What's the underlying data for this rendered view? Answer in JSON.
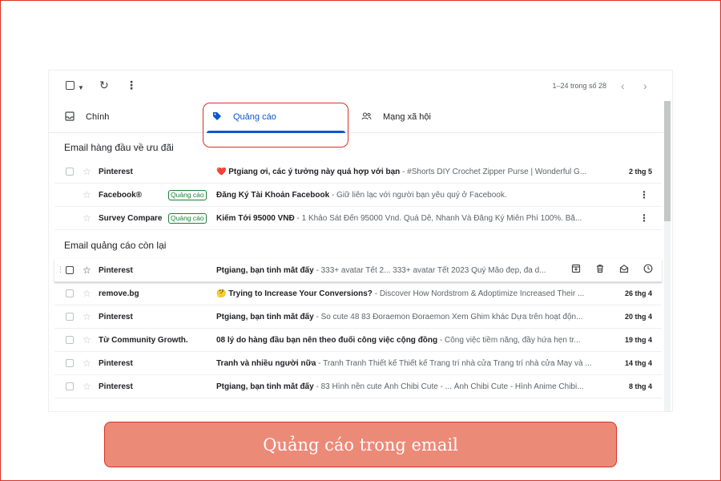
{
  "toolbar": {
    "range_text": "1–24 trong số 28"
  },
  "tabs": [
    {
      "label": "Chính",
      "icon": "inbox-icon"
    },
    {
      "label": "Quảng cáo",
      "icon": "tag-icon",
      "selected": true
    },
    {
      "label": "Mạng xã hội",
      "icon": "people-icon"
    }
  ],
  "sections": {
    "top_title": "Email hàng đầu về ưu đãi",
    "rest_title": "Email quảng cáo còn lại"
  },
  "top_rows": [
    {
      "sender": "Pinterest",
      "badge": "",
      "prefix": "❤️ ",
      "subject": "Ptgiang ơi, các ý tưởng này quá hợp với bạn",
      "preview": "#Shorts DIY Crochet Zipper Purse | Wonderful G...",
      "date": "2 thg 5"
    },
    {
      "sender": "Facebook®",
      "badge": "Quảng cáo",
      "prefix": "",
      "subject": "Đăng Ký Tài Khoản Facebook",
      "preview": "Giữ liên lạc với người bạn yêu quý ở Facebook.",
      "date": ""
    },
    {
      "sender": "Survey Compare",
      "badge": "Quảng cáo",
      "prefix": "",
      "subject": "Kiếm Tới 95000 VNĐ",
      "preview": "1 Khảo Sát Đến 95000 Vnd. Quá Dễ, Nhanh Và Đăng Ký Miễn Phí 100%. Bắ...",
      "date": ""
    }
  ],
  "rest_rows": [
    {
      "sender": "Pinterest",
      "prefix": "",
      "subject": "Ptgiang, bạn tinh mắt đấy",
      "preview": "333+ avatar Tết 2... 333+ avatar Tết 2023 Quý Mão đẹp, đa d...",
      "date": ""
    },
    {
      "sender": "remove.bg",
      "prefix": "🤔 ",
      "subject": "Trying to Increase Your Conversions?",
      "preview": "Discover How Nordstrom & Adoptimize Increased Their ...",
      "date": "26 thg 4"
    },
    {
      "sender": "Pinterest",
      "prefix": "",
      "subject": "Ptgiang, bạn tinh mắt đấy",
      "preview": "So cute 48 83 Đoraemon Đoraemon Xem Ghim khác Dựa trên hoạt độn...",
      "date": "20 thg 4"
    },
    {
      "sender": "Từ Community Growth.",
      "prefix": "",
      "subject": "08 lý do hàng đầu bạn nên theo đuổi công việc cộng đồng",
      "preview": "Công việc tiềm năng, đầy hứa hẹn tr...",
      "date": "19 thg 4"
    },
    {
      "sender": "Pinterest",
      "prefix": "",
      "subject": "Tranh và nhiều người nữa",
      "preview": "Tranh Tranh Thiết kế Thiết kế Trang trí nhà cửa Trang trí nhà cửa May và ...",
      "date": "14 thg 4"
    },
    {
      "sender": "Pinterest",
      "prefix": "",
      "subject": "Ptgiang, bạn tinh mắt đấy",
      "preview": "83 Hình nền cute Ảnh Chibi Cute - ... Ảnh Chibi Cute - Hình Anime Chibi...",
      "date": "8 thg 4"
    }
  ],
  "caption": "Quảng cáo trong email",
  "colors": {
    "accent": "#0b57d0",
    "highlight_border": "#d93025",
    "caption_bg": "#ec8a78",
    "badge": "#188038"
  }
}
